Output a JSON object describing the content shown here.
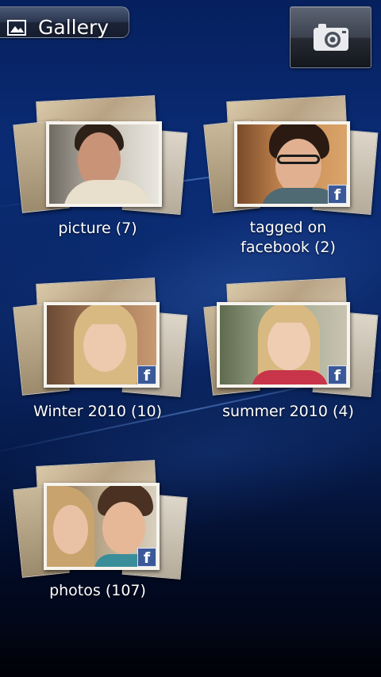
{
  "header": {
    "title": "Gallery",
    "title_icon": "image-icon",
    "camera_button_icon": "camera-icon"
  },
  "albums": [
    {
      "label": "picture  (7)",
      "facebook": false
    },
    {
      "label_line1": "tagged on",
      "label_line2": "facebook  (2)",
      "facebook": true
    },
    {
      "label": "Winter 2010 (10)",
      "facebook": true
    },
    {
      "label": "summer 2010  (4)",
      "facebook": true
    },
    {
      "label": "photos  (107)",
      "facebook": true
    }
  ],
  "badges": {
    "facebook_letter": "f"
  },
  "colors": {
    "facebook_blue": "#3b5998",
    "background_top": "#06205e",
    "background_bottom": "#01040f"
  }
}
